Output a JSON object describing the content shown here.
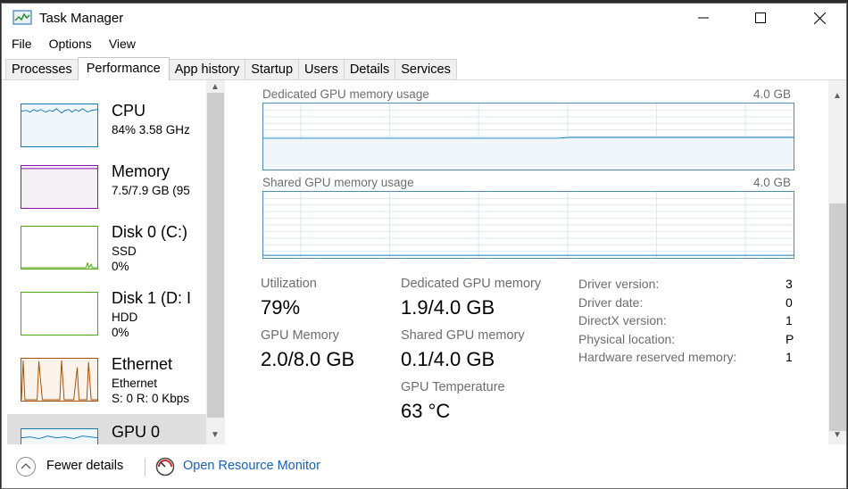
{
  "window": {
    "title": "Task Manager"
  },
  "menu": [
    "File",
    "Options",
    "View"
  ],
  "tabs": [
    {
      "label": "Processes",
      "active": false
    },
    {
      "label": "Performance",
      "active": true
    },
    {
      "label": "App history",
      "active": false
    },
    {
      "label": "Startup",
      "active": false
    },
    {
      "label": "Users",
      "active": false
    },
    {
      "label": "Details",
      "active": false
    },
    {
      "label": "Services",
      "active": false
    }
  ],
  "sidebar": {
    "items": [
      {
        "name": "CPU",
        "sub1": "84% 3.58 GHz",
        "sub2": "",
        "color": "#117dbb",
        "fill": "#f1f6fa"
      },
      {
        "name": "Memory",
        "sub1": "7.5/7.9 GB (95",
        "sub2": "",
        "color": "#8b12ae",
        "fill": "#f4f0f5"
      },
      {
        "name": "Disk 0 (C:)",
        "sub1": "SSD",
        "sub2": "0%",
        "color": "#4da60c",
        "fill": "#ffffff"
      },
      {
        "name": "Disk 1 (D: I",
        "sub1": "HDD",
        "sub2": "0%",
        "color": "#4da60c",
        "fill": "#ffffff"
      },
      {
        "name": "Ethernet",
        "sub1": "Ethernet",
        "sub2": "S: 0 R: 0 Kbps",
        "color": "#a74f01",
        "fill": "#fcf3eb"
      },
      {
        "name": "GPU 0",
        "sub1": "",
        "sub2": "",
        "color": "#117dbb",
        "fill": "#f1f6fa"
      }
    ]
  },
  "main": {
    "dedicated_graph": {
      "label": "Dedicated GPU memory usage",
      "max": "4.0 GB",
      "level": 0.47
    },
    "shared_graph": {
      "label": "Shared GPU memory usage",
      "max": "4.0 GB",
      "level": 0.03
    },
    "stats": {
      "utilization": {
        "label": "Utilization",
        "value": "79%"
      },
      "gpu_memory": {
        "label": "GPU Memory",
        "value": "2.0/8.0 GB"
      },
      "dedicated": {
        "label": "Dedicated GPU memory",
        "value": "1.9/4.0 GB"
      },
      "shared": {
        "label": "Shared GPU memory",
        "value": "0.1/4.0 GB"
      },
      "temperature": {
        "label": "GPU Temperature",
        "value": "63 °C"
      }
    },
    "driver": [
      {
        "label": "Driver version:",
        "value": "3"
      },
      {
        "label": "Driver date:",
        "value": "0"
      },
      {
        "label": "DirectX version:",
        "value": "1"
      },
      {
        "label": "Physical location:",
        "value": "P"
      },
      {
        "label": "Hardware reserved memory:",
        "value": "1"
      }
    ]
  },
  "footer": {
    "fewer_details": "Fewer details",
    "open_monitor": "Open Resource Monitor"
  },
  "icons": {
    "app": "task-manager-icon",
    "minimize": "minimize-icon",
    "maximize": "maximize-icon",
    "close": "close-icon",
    "fewer": "chevron-up-icon",
    "monitor": "resource-monitor-icon"
  }
}
